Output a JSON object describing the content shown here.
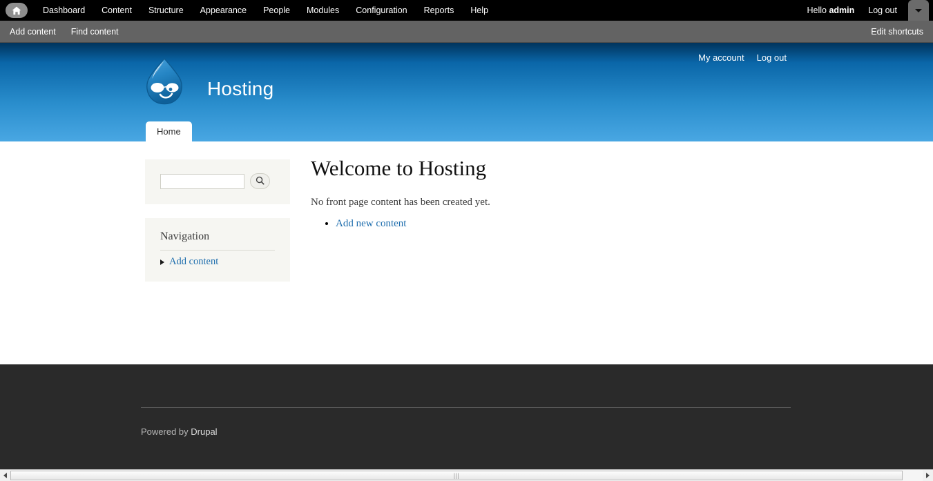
{
  "toolbar": {
    "home_icon": "home-icon",
    "menu": [
      {
        "label": "Dashboard"
      },
      {
        "label": "Content"
      },
      {
        "label": "Structure"
      },
      {
        "label": "Appearance"
      },
      {
        "label": "People"
      },
      {
        "label": "Modules"
      },
      {
        "label": "Configuration"
      },
      {
        "label": "Reports"
      },
      {
        "label": "Help"
      }
    ],
    "greeting_prefix": "Hello ",
    "username": "admin",
    "logout_label": "Log out",
    "toggle_icon": "chevron-down-icon"
  },
  "shortcuts": {
    "items": [
      {
        "label": "Add content"
      },
      {
        "label": "Find content"
      }
    ],
    "edit_label": "Edit shortcuts"
  },
  "header": {
    "logo_icon": "drupal-drop-logo",
    "site_name": "Hosting",
    "account_links": [
      {
        "label": "My account"
      },
      {
        "label": "Log out"
      }
    ],
    "tabs": [
      {
        "label": "Home"
      }
    ]
  },
  "sidebar": {
    "search": {
      "value": "",
      "placeholder": "",
      "button_icon": "search-icon"
    },
    "navigation": {
      "title": "Navigation",
      "items": [
        {
          "label": "Add content"
        }
      ]
    }
  },
  "main": {
    "title": "Welcome to Hosting",
    "body_text": "No front page content has been created yet.",
    "links": [
      {
        "label": "Add new content"
      }
    ]
  },
  "footer": {
    "powered_prefix": "Powered by ",
    "powered_link": "Drupal"
  },
  "scrollbar": {
    "left_arrow_icon": "arrow-left-icon",
    "right_arrow_icon": "arrow-right-icon",
    "grip_glyph": "|||"
  },
  "colors": {
    "toolbar_bg": "#000000",
    "shortcut_bg": "#636363",
    "header_gradient_top": "#00335c",
    "header_gradient_bottom": "#49a7e3",
    "link": "#1d6dad",
    "block_bg": "#f6f6f2",
    "footer_bg": "#2a2a2a"
  }
}
